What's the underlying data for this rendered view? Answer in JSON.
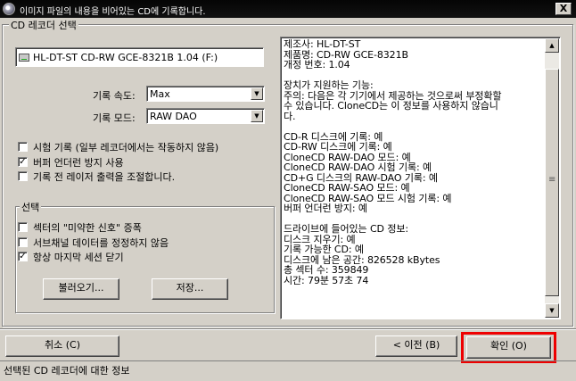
{
  "window": {
    "title": "이미지 파일의 내용을 비어있는 CD에 기록합니다.",
    "close_label": "X"
  },
  "section_label": "CD 레코더 선택",
  "drive": {
    "name": "HL-DT-ST CD-RW GCE-8321B 1.04 (F:)"
  },
  "write_speed": {
    "label": "기록 속도:",
    "value": "Max"
  },
  "write_mode": {
    "label": "기록 모드:",
    "value": "RAW DAO"
  },
  "options": [
    {
      "label": "시험 기록 (일부 레코더에서는 작동하지 않음)",
      "checked": false
    },
    {
      "label": "버퍼 언더런 방지 사용",
      "checked": true
    },
    {
      "label": "기록 전 레이저 출력을 조절합니다.",
      "checked": false
    }
  ],
  "select_group": {
    "label": "선택",
    "options": [
      {
        "label": "섹터의 \"미약한 신호\" 증폭",
        "checked": false
      },
      {
        "label": "서브채널 데이터를 정정하지 않음",
        "checked": false
      },
      {
        "label": "항상 마지막 세션 닫기",
        "checked": true
      }
    ],
    "load_button": "불러오기...",
    "save_button": "저장..."
  },
  "info_text": "제조사: HL-DT-ST\n제품명: CD-RW GCE-8321B\n개정 번호: 1.04\n\n장치가 지원하는 기능:\n주의: 다음은 각 기기에서 제공하는 것으로써 부정확할\n수 있습니다. CloneCD는 이 정보를 사용하지 않습니\n다.\n\nCD-R 디스크에 기록: 예\nCD-RW 디스크에 기록: 예\nCloneCD RAW-DAO 모드: 예\nCloneCD RAW-DAO 시험 기록: 예\nCD+G 디스크의 RAW-DAO 기록: 예\nCloneCD RAW-SAO 모드: 예\nCloneCD RAW-SAO 모드 시험 기록: 예\n버퍼 언더런 방지: 예\n\n드라이브에 들어있는 CD 정보:\n디스크 지우기: 예\n기록 가능한 CD: 예\n디스크에 남은 공간: 826528 kBytes\n총 섹터 수: 359849\n시간: 79분 57초 74",
  "buttons": {
    "cancel": "취소 (C)",
    "back": "< 이전 (B)",
    "ok": "확인 (O)"
  },
  "status_text": "선택된 CD 레코더에 대한 정보",
  "colors": {
    "highlight": "#ee0000",
    "face": "#d4d0c8"
  }
}
